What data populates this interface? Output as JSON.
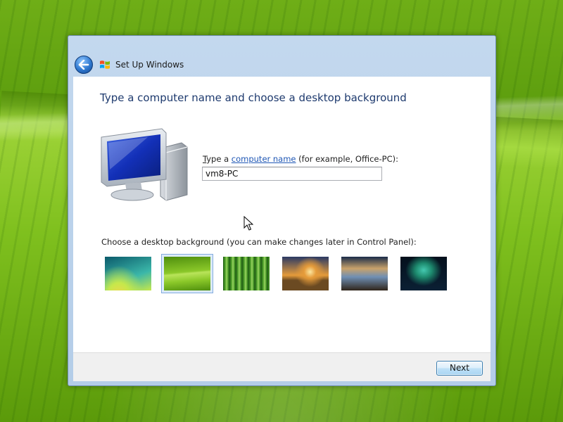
{
  "window": {
    "title": "Set Up Windows",
    "back_icon": "back-arrow-icon",
    "logo_icon": "windows-logo-icon"
  },
  "main": {
    "heading": "Type a computer name and choose a desktop background",
    "computer_name": {
      "label_prefix_underlined": "T",
      "label_prefix_rest": "ype a ",
      "label_link": "computer name",
      "label_suffix": " (for example, Office-PC):",
      "value": "vm8-PC"
    },
    "background": {
      "label": "Choose a desktop background (you can make changes later in Control Panel):",
      "selected_index": 1,
      "thumbnails": [
        {
          "name": "thumb-aurora-swirl",
          "colors": [
            "#0b5a6b",
            "#3bb7a9",
            "#c6e84b",
            "#f5d44c"
          ]
        },
        {
          "name": "thumb-green-leaf",
          "colors": [
            "#4f8f0e",
            "#8bc829",
            "#b9e45a"
          ]
        },
        {
          "name": "thumb-bamboo",
          "colors": [
            "#1f5a14",
            "#4fa12b",
            "#9bd562"
          ]
        },
        {
          "name": "thumb-sunset-meadow",
          "colors": [
            "#2b3a64",
            "#e59b3a",
            "#fbe6a0",
            "#6b4a22"
          ]
        },
        {
          "name": "thumb-mountain-lake",
          "colors": [
            "#1a2c4a",
            "#c9a26a",
            "#6f8fb4",
            "#30251a"
          ]
        },
        {
          "name": "thumb-northern-lights",
          "colors": [
            "#04101c",
            "#1d8a6e",
            "#44c9b0",
            "#0b2034"
          ]
        }
      ]
    }
  },
  "footer": {
    "next_label": "Next"
  },
  "colors": {
    "heading": "#1e3a6e",
    "link": "#1f57b5",
    "titlebar": "#b4cde8"
  }
}
